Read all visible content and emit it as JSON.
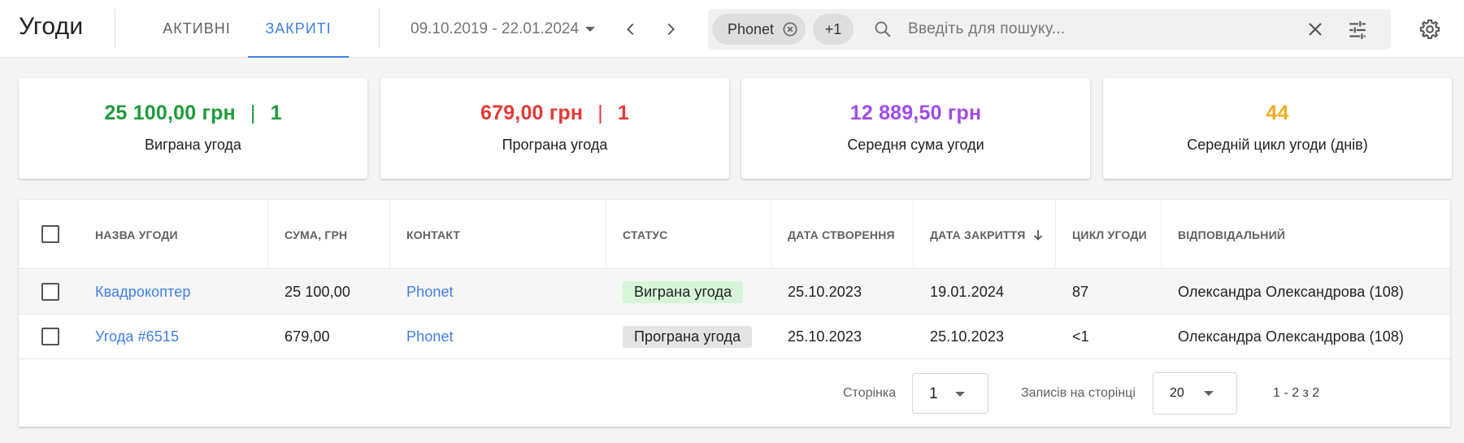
{
  "header": {
    "title": "Угоди",
    "tabs": [
      {
        "label": "АКТИВНІ",
        "active": false
      },
      {
        "label": "ЗАКРИТІ",
        "active": true
      }
    ],
    "date_range": "09.10.2019 - 22.01.2024",
    "search": {
      "chips": [
        "Phonet",
        "+1"
      ],
      "placeholder": "Введіть для пошуку...",
      "value": ""
    }
  },
  "stats": [
    {
      "amount": "25 100,00 грн",
      "separator": "|",
      "count": "1",
      "label": "Виграна угода",
      "color": "#1e9b3b"
    },
    {
      "amount": "679,00 грн",
      "separator": "|",
      "count": "1",
      "label": "Програна угода",
      "color": "#e53935"
    },
    {
      "amount": "12 889,50 грн",
      "label": "Середня сума угоди",
      "color": "#a24be8"
    },
    {
      "amount": "44",
      "label": "Середній цикл угоди (днів)",
      "color": "#f3ac1c"
    }
  ],
  "table": {
    "columns": [
      "НАЗВА УГОДИ",
      "СУМА, ГРН",
      "КОНТАКТ",
      "СТАТУС",
      "ДАТА СТВОРЕННЯ",
      "ДАТА ЗАКРИТТЯ",
      "ЦИКЛ УГОДИ",
      "ВІДПОВІДАЛЬНИЙ"
    ],
    "sorted_column": "ДАТА ЗАКРИТТЯ",
    "sort_direction": "descending",
    "rows": [
      {
        "name": "Квадрокоптер",
        "sum": "25 100,00",
        "contact": "Phonet",
        "status": "Виграна угода",
        "created": "25.10.2023",
        "closed": "19.01.2024",
        "cycle": "87",
        "owner": "Олександра Олександрова (108)"
      },
      {
        "name": "Угода #6515",
        "sum": "679,00",
        "contact": "Phonet",
        "status": "Програна угода",
        "created": "25.10.2023",
        "closed": "25.10.2023",
        "cycle": "<1",
        "owner": "Олександра Олександрова (108)"
      }
    ]
  },
  "pagination": {
    "page_label": "Сторінка",
    "page_value": "1",
    "per_page_label": "Записів на сторінці",
    "per_page_value": "20",
    "range": "1 - 2 з 2"
  },
  "colors": {
    "accent": "#3f7fe6",
    "won_badge": "#d7f5d9",
    "lost_badge": "#e4e4e4"
  },
  "icons": [
    "chevron-left-icon",
    "chevron-right-icon",
    "search-icon",
    "close-icon",
    "tune-icon",
    "gear-icon",
    "arrow-down-icon"
  ]
}
